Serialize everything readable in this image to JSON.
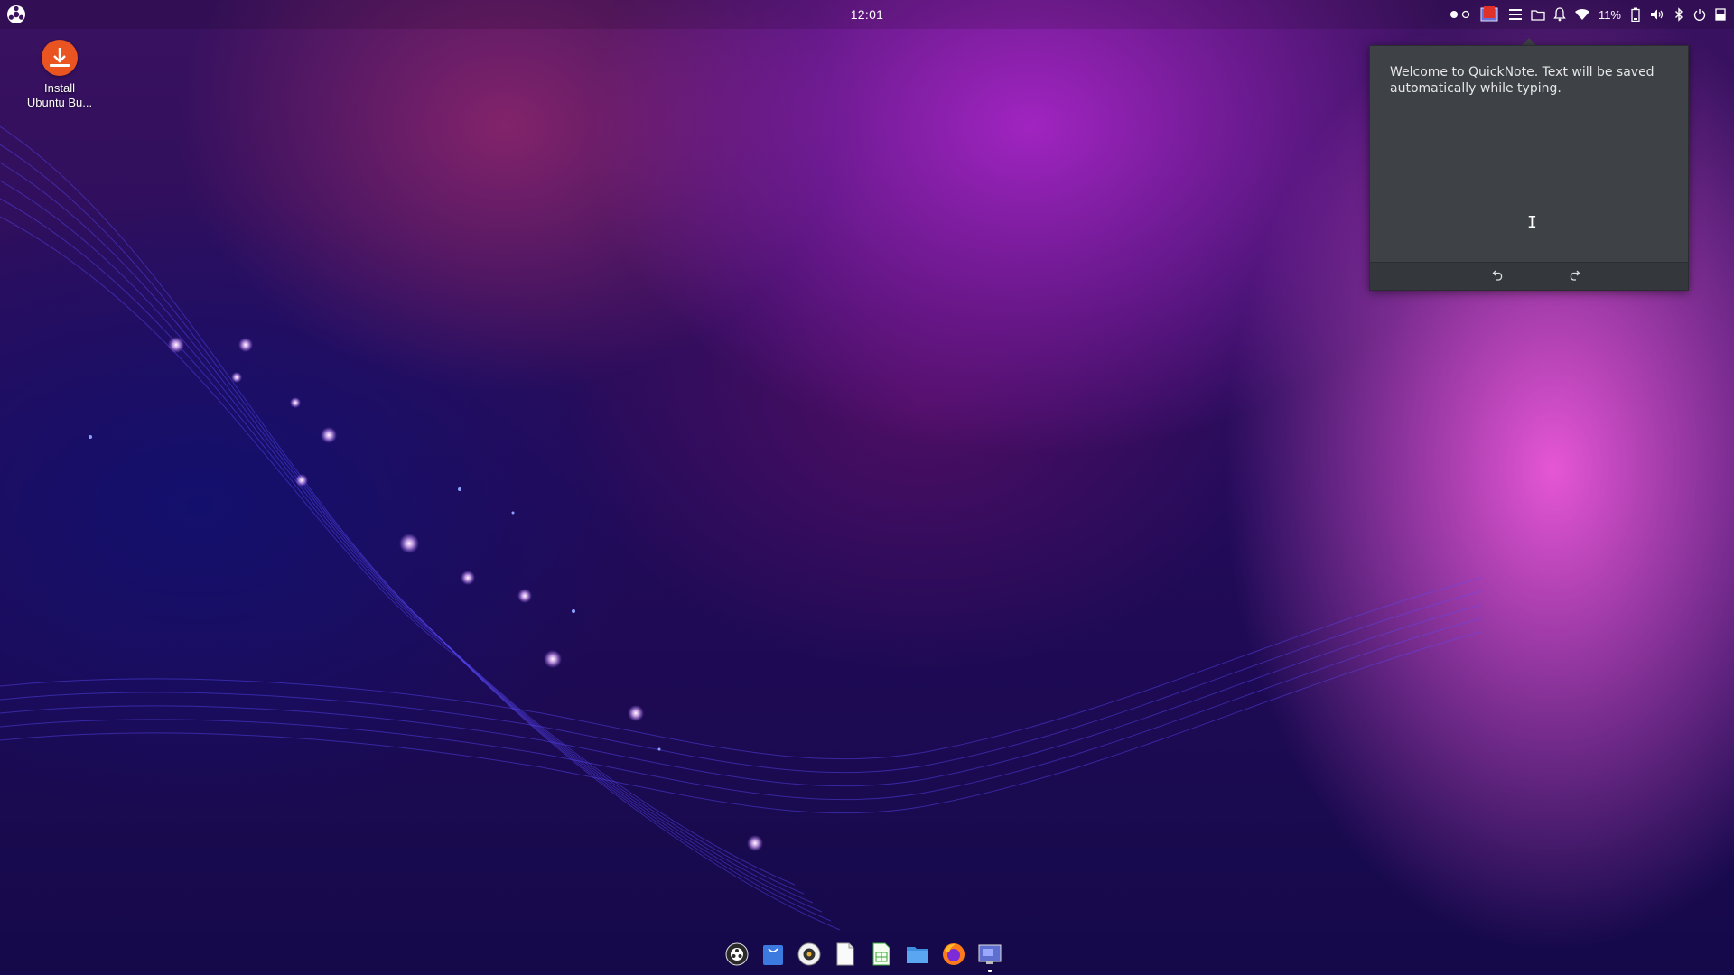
{
  "topbar": {
    "clock": "12:01",
    "battery_percent": "11%"
  },
  "desktop": {
    "icons": [
      {
        "label_line1": "Install",
        "label_line2": "Ubuntu Bu...",
        "icon": "download-icon"
      }
    ]
  },
  "quicknote": {
    "text": "Welcome to QuickNote. Text will be saved automatically while typing.",
    "undo_icon": "undo-icon",
    "redo_icon": "redo-icon"
  },
  "dock": {
    "items": [
      {
        "name": "ubuntu-budgie-welcome",
        "icon": "budgie-welcome-icon"
      },
      {
        "name": "software-store",
        "icon": "shopping-bag-icon"
      },
      {
        "name": "rhythmbox",
        "icon": "speaker-icon"
      },
      {
        "name": "text-editor",
        "icon": "document-icon"
      },
      {
        "name": "spreadsheet",
        "icon": "spreadsheet-icon"
      },
      {
        "name": "files",
        "icon": "folder-icon"
      },
      {
        "name": "firefox",
        "icon": "firefox-icon"
      },
      {
        "name": "screenshot-tool",
        "icon": "screenshot-icon",
        "running": true
      }
    ]
  },
  "colors": {
    "accent_orange": "#e95420",
    "note_bg": "#3e4146",
    "note_footer": "#34373b"
  }
}
